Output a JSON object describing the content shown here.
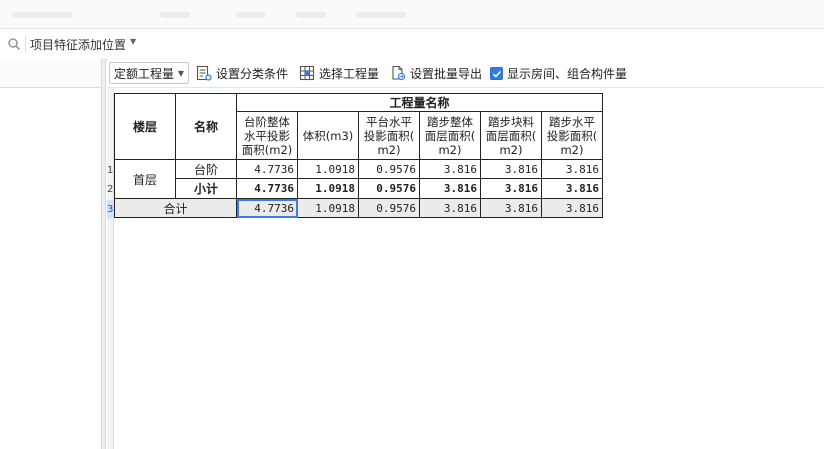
{
  "search": {
    "placeholder_label": "项目特征添加位置",
    "icon": "search-icon"
  },
  "toolbar": {
    "quota_select": "定额工程量",
    "set_category_conditions": "设置分类条件",
    "select_quantity": "选择工程量",
    "set_batch_export": "设置批量导出",
    "show_rooms": "显示房间、组合构件量",
    "show_rooms_checked": true
  },
  "row_numbers": [
    "1",
    "2",
    "3"
  ],
  "table": {
    "header_floor": "楼层",
    "header_name": "名称",
    "header_group": "工程量名称",
    "columns": [
      [
        "台阶整体",
        "水平投影",
        "面积(m2)"
      ],
      [
        "体积(m3)"
      ],
      [
        "平台水平",
        "投影面积(",
        "m2)"
      ],
      [
        "踏步整体",
        "面层面积(",
        "m2)"
      ],
      [
        "踏步块料",
        "面层面积(",
        "m2)"
      ],
      [
        "踏步水平",
        "投影面积(",
        "m2)"
      ]
    ],
    "rows": [
      {
        "floor": "首层",
        "name": "台阶",
        "values": [
          "4.7736",
          "1.0918",
          "0.9576",
          "3.816",
          "3.816",
          "3.816"
        ]
      },
      {
        "name": "小计",
        "values": [
          "4.7736",
          "1.0918",
          "0.9576",
          "3.816",
          "3.816",
          "3.816"
        ]
      }
    ],
    "total": {
      "label": "合计",
      "values": [
        "4.7736",
        "1.0918",
        "0.9576",
        "3.816",
        "3.816",
        "3.816"
      ]
    }
  },
  "colors": {
    "accent": "#2f7de1",
    "total_row_bg": "#ebebeb"
  }
}
